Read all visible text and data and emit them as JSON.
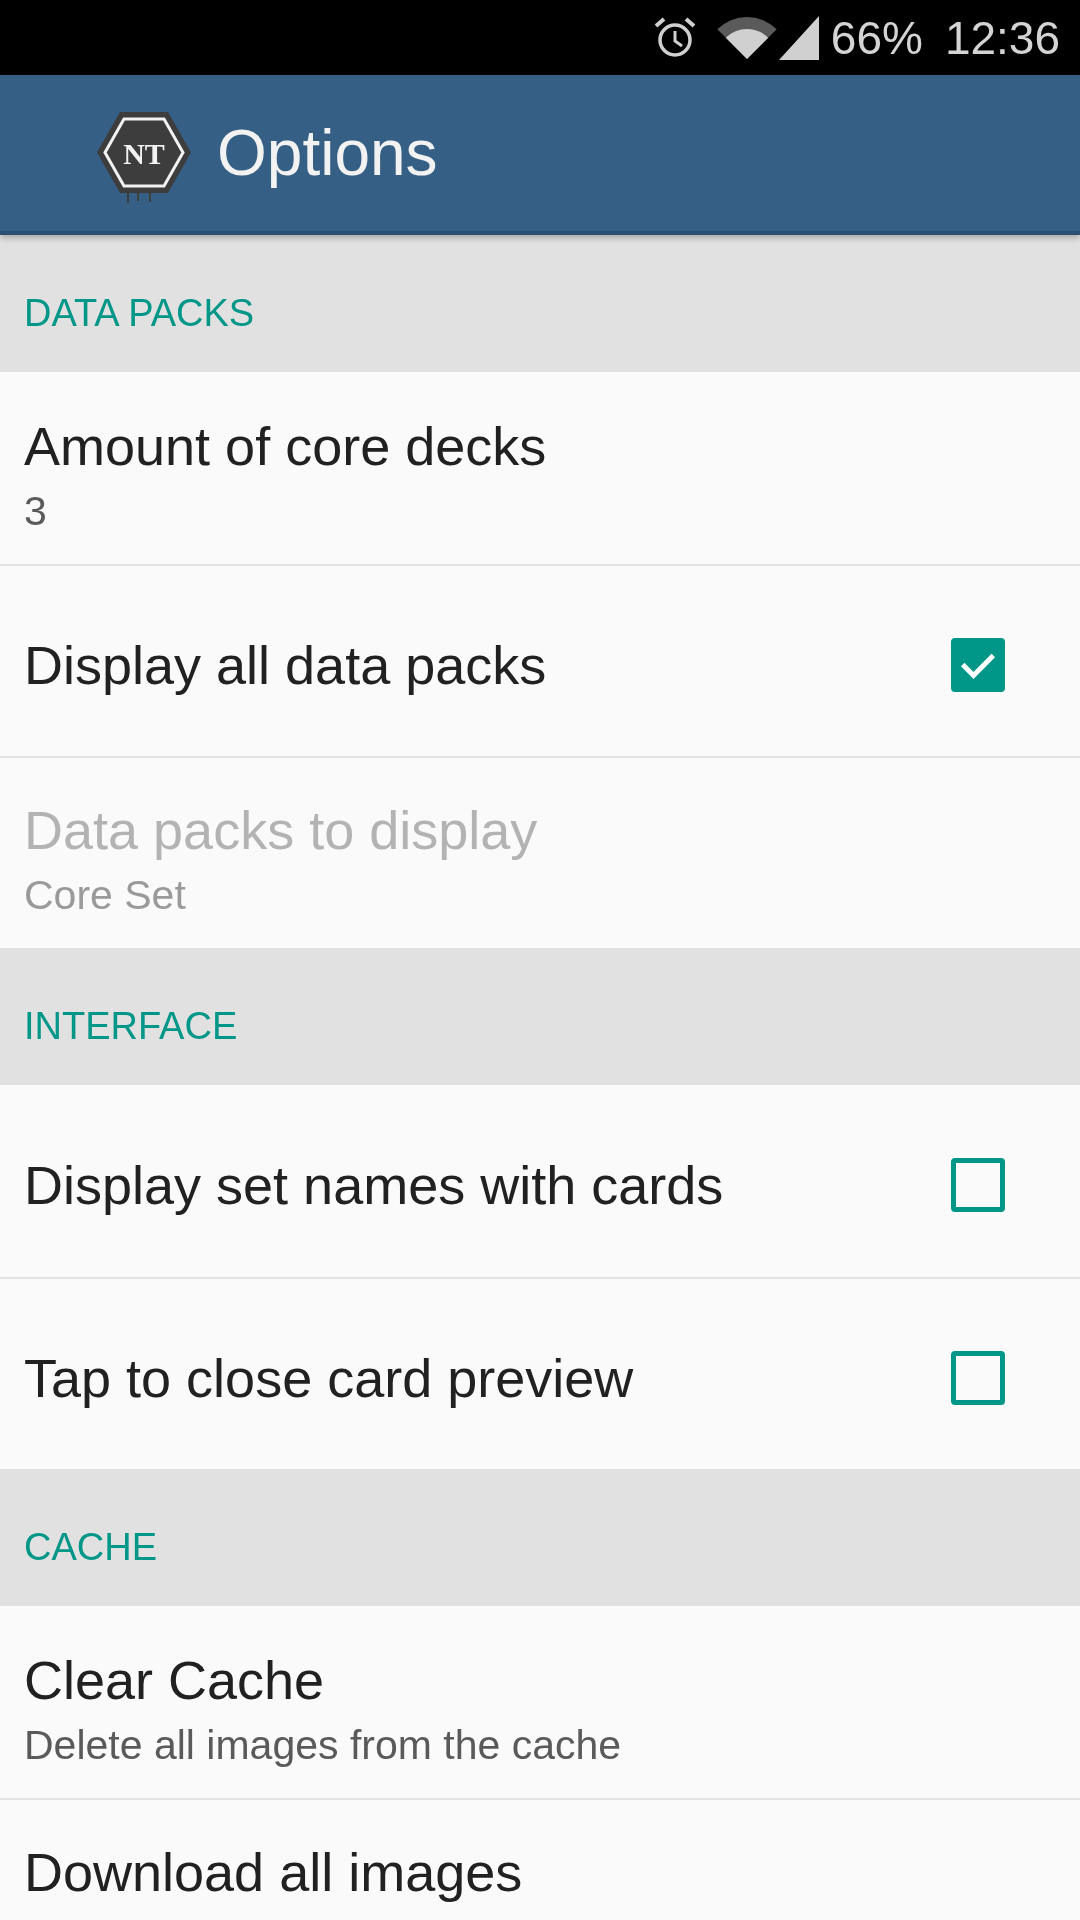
{
  "status_bar": {
    "battery": "66%",
    "time": "12:36"
  },
  "app_bar": {
    "logo": "NT",
    "title": "Options"
  },
  "sections": [
    {
      "header": "DATA PACKS",
      "items": [
        {
          "kind": "value",
          "title": "Amount of core decks",
          "summary": "3",
          "disabled": false
        },
        {
          "kind": "checkbox",
          "title": "Display all data packs",
          "checked": true,
          "disabled": false
        },
        {
          "kind": "value",
          "title": "Data packs to display",
          "summary": "Core Set",
          "disabled": true
        }
      ]
    },
    {
      "header": "INTERFACE",
      "items": [
        {
          "kind": "checkbox",
          "title": "Display set names with cards",
          "checked": false,
          "disabled": false
        },
        {
          "kind": "checkbox",
          "title": "Tap to close card preview",
          "checked": false,
          "disabled": false
        }
      ]
    },
    {
      "header": "CACHE",
      "items": [
        {
          "kind": "value",
          "title": "Clear Cache",
          "summary": "Delete all images from the cache",
          "disabled": false
        },
        {
          "kind": "value",
          "title": "Download all images",
          "disabled": false
        }
      ]
    }
  ]
}
